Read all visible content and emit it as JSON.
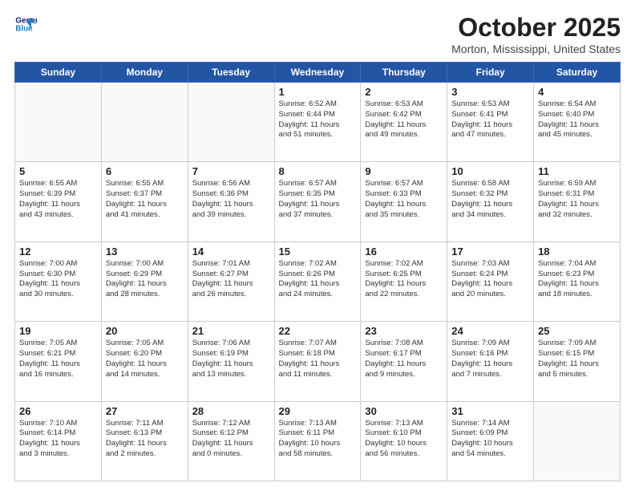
{
  "header": {
    "logo_line1": "General",
    "logo_line2": "Blue",
    "month": "October 2025",
    "location": "Morton, Mississippi, United States"
  },
  "weekdays": [
    "Sunday",
    "Monday",
    "Tuesday",
    "Wednesday",
    "Thursday",
    "Friday",
    "Saturday"
  ],
  "weeks": [
    [
      {
        "date": "",
        "content": ""
      },
      {
        "date": "",
        "content": ""
      },
      {
        "date": "",
        "content": ""
      },
      {
        "date": "1",
        "content": "Sunrise: 6:52 AM\nSunset: 6:44 PM\nDaylight: 11 hours\nand 51 minutes."
      },
      {
        "date": "2",
        "content": "Sunrise: 6:53 AM\nSunset: 6:42 PM\nDaylight: 11 hours\nand 49 minutes."
      },
      {
        "date": "3",
        "content": "Sunrise: 6:53 AM\nSunset: 6:41 PM\nDaylight: 11 hours\nand 47 minutes."
      },
      {
        "date": "4",
        "content": "Sunrise: 6:54 AM\nSunset: 6:40 PM\nDaylight: 11 hours\nand 45 minutes."
      }
    ],
    [
      {
        "date": "5",
        "content": "Sunrise: 6:55 AM\nSunset: 6:39 PM\nDaylight: 11 hours\nand 43 minutes."
      },
      {
        "date": "6",
        "content": "Sunrise: 6:55 AM\nSunset: 6:37 PM\nDaylight: 11 hours\nand 41 minutes."
      },
      {
        "date": "7",
        "content": "Sunrise: 6:56 AM\nSunset: 6:36 PM\nDaylight: 11 hours\nand 39 minutes."
      },
      {
        "date": "8",
        "content": "Sunrise: 6:57 AM\nSunset: 6:35 PM\nDaylight: 11 hours\nand 37 minutes."
      },
      {
        "date": "9",
        "content": "Sunrise: 6:57 AM\nSunset: 6:33 PM\nDaylight: 11 hours\nand 35 minutes."
      },
      {
        "date": "10",
        "content": "Sunrise: 6:58 AM\nSunset: 6:32 PM\nDaylight: 11 hours\nand 34 minutes."
      },
      {
        "date": "11",
        "content": "Sunrise: 6:59 AM\nSunset: 6:31 PM\nDaylight: 11 hours\nand 32 minutes."
      }
    ],
    [
      {
        "date": "12",
        "content": "Sunrise: 7:00 AM\nSunset: 6:30 PM\nDaylight: 11 hours\nand 30 minutes."
      },
      {
        "date": "13",
        "content": "Sunrise: 7:00 AM\nSunset: 6:29 PM\nDaylight: 11 hours\nand 28 minutes."
      },
      {
        "date": "14",
        "content": "Sunrise: 7:01 AM\nSunset: 6:27 PM\nDaylight: 11 hours\nand 26 minutes."
      },
      {
        "date": "15",
        "content": "Sunrise: 7:02 AM\nSunset: 6:26 PM\nDaylight: 11 hours\nand 24 minutes."
      },
      {
        "date": "16",
        "content": "Sunrise: 7:02 AM\nSunset: 6:25 PM\nDaylight: 11 hours\nand 22 minutes."
      },
      {
        "date": "17",
        "content": "Sunrise: 7:03 AM\nSunset: 6:24 PM\nDaylight: 11 hours\nand 20 minutes."
      },
      {
        "date": "18",
        "content": "Sunrise: 7:04 AM\nSunset: 6:23 PM\nDaylight: 11 hours\nand 18 minutes."
      }
    ],
    [
      {
        "date": "19",
        "content": "Sunrise: 7:05 AM\nSunset: 6:21 PM\nDaylight: 11 hours\nand 16 minutes."
      },
      {
        "date": "20",
        "content": "Sunrise: 7:05 AM\nSunset: 6:20 PM\nDaylight: 11 hours\nand 14 minutes."
      },
      {
        "date": "21",
        "content": "Sunrise: 7:06 AM\nSunset: 6:19 PM\nDaylight: 11 hours\nand 13 minutes."
      },
      {
        "date": "22",
        "content": "Sunrise: 7:07 AM\nSunset: 6:18 PM\nDaylight: 11 hours\nand 11 minutes."
      },
      {
        "date": "23",
        "content": "Sunrise: 7:08 AM\nSunset: 6:17 PM\nDaylight: 11 hours\nand 9 minutes."
      },
      {
        "date": "24",
        "content": "Sunrise: 7:09 AM\nSunset: 6:16 PM\nDaylight: 11 hours\nand 7 minutes."
      },
      {
        "date": "25",
        "content": "Sunrise: 7:09 AM\nSunset: 6:15 PM\nDaylight: 11 hours\nand 5 minutes."
      }
    ],
    [
      {
        "date": "26",
        "content": "Sunrise: 7:10 AM\nSunset: 6:14 PM\nDaylight: 11 hours\nand 3 minutes."
      },
      {
        "date": "27",
        "content": "Sunrise: 7:11 AM\nSunset: 6:13 PM\nDaylight: 11 hours\nand 2 minutes."
      },
      {
        "date": "28",
        "content": "Sunrise: 7:12 AM\nSunset: 6:12 PM\nDaylight: 11 hours\nand 0 minutes."
      },
      {
        "date": "29",
        "content": "Sunrise: 7:13 AM\nSunset: 6:11 PM\nDaylight: 10 hours\nand 58 minutes."
      },
      {
        "date": "30",
        "content": "Sunrise: 7:13 AM\nSunset: 6:10 PM\nDaylight: 10 hours\nand 56 minutes."
      },
      {
        "date": "31",
        "content": "Sunrise: 7:14 AM\nSunset: 6:09 PM\nDaylight: 10 hours\nand 54 minutes."
      },
      {
        "date": "",
        "content": ""
      }
    ]
  ]
}
